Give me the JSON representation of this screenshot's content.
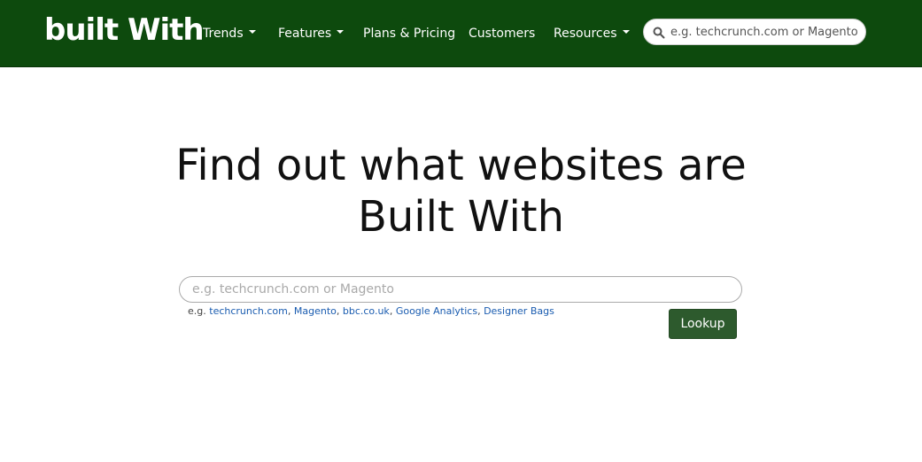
{
  "brand": {
    "logo_text": "built With"
  },
  "nav": {
    "trends": "Trends",
    "features": "Features",
    "plans_pricing": "Plans & Pricing",
    "customers": "Customers",
    "resources": "Resources",
    "search_placeholder": "e.g. techcrunch.com or Magento"
  },
  "hero": {
    "line1": "Find out what websites are",
    "line2": "Built With"
  },
  "main_search": {
    "placeholder": "e.g. techcrunch.com or Magento",
    "examples_prefix": "e.g. ",
    "examples": [
      "techcrunch.com",
      "Magento",
      "bbc.co.uk",
      "Google Analytics",
      "Designer Bags"
    ],
    "lookup_label": "Lookup"
  },
  "colors": {
    "navbar": "#0d4a0d",
    "lookup_button": "#2d5a2d",
    "link": "#1a5cb0"
  },
  "icons": {
    "nav_search": "search-icon",
    "dropdown": "caret-down-icon"
  }
}
